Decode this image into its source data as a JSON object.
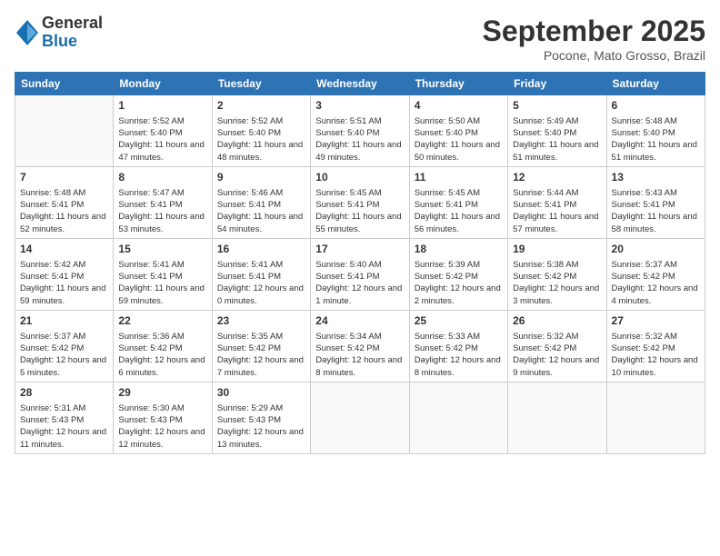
{
  "header": {
    "logo_general": "General",
    "logo_blue": "Blue",
    "month_title": "September 2025",
    "location": "Pocone, Mato Grosso, Brazil"
  },
  "days_of_week": [
    "Sunday",
    "Monday",
    "Tuesday",
    "Wednesday",
    "Thursday",
    "Friday",
    "Saturday"
  ],
  "weeks": [
    [
      {
        "day": "",
        "sunrise": "",
        "sunset": "",
        "daylight": ""
      },
      {
        "day": "1",
        "sunrise": "Sunrise: 5:52 AM",
        "sunset": "Sunset: 5:40 PM",
        "daylight": "Daylight: 11 hours and 47 minutes."
      },
      {
        "day": "2",
        "sunrise": "Sunrise: 5:52 AM",
        "sunset": "Sunset: 5:40 PM",
        "daylight": "Daylight: 11 hours and 48 minutes."
      },
      {
        "day": "3",
        "sunrise": "Sunrise: 5:51 AM",
        "sunset": "Sunset: 5:40 PM",
        "daylight": "Daylight: 11 hours and 49 minutes."
      },
      {
        "day": "4",
        "sunrise": "Sunrise: 5:50 AM",
        "sunset": "Sunset: 5:40 PM",
        "daylight": "Daylight: 11 hours and 50 minutes."
      },
      {
        "day": "5",
        "sunrise": "Sunrise: 5:49 AM",
        "sunset": "Sunset: 5:40 PM",
        "daylight": "Daylight: 11 hours and 51 minutes."
      },
      {
        "day": "6",
        "sunrise": "Sunrise: 5:48 AM",
        "sunset": "Sunset: 5:40 PM",
        "daylight": "Daylight: 11 hours and 51 minutes."
      }
    ],
    [
      {
        "day": "7",
        "sunrise": "Sunrise: 5:48 AM",
        "sunset": "Sunset: 5:41 PM",
        "daylight": "Daylight: 11 hours and 52 minutes."
      },
      {
        "day": "8",
        "sunrise": "Sunrise: 5:47 AM",
        "sunset": "Sunset: 5:41 PM",
        "daylight": "Daylight: 11 hours and 53 minutes."
      },
      {
        "day": "9",
        "sunrise": "Sunrise: 5:46 AM",
        "sunset": "Sunset: 5:41 PM",
        "daylight": "Daylight: 11 hours and 54 minutes."
      },
      {
        "day": "10",
        "sunrise": "Sunrise: 5:45 AM",
        "sunset": "Sunset: 5:41 PM",
        "daylight": "Daylight: 11 hours and 55 minutes."
      },
      {
        "day": "11",
        "sunrise": "Sunrise: 5:45 AM",
        "sunset": "Sunset: 5:41 PM",
        "daylight": "Daylight: 11 hours and 56 minutes."
      },
      {
        "day": "12",
        "sunrise": "Sunrise: 5:44 AM",
        "sunset": "Sunset: 5:41 PM",
        "daylight": "Daylight: 11 hours and 57 minutes."
      },
      {
        "day": "13",
        "sunrise": "Sunrise: 5:43 AM",
        "sunset": "Sunset: 5:41 PM",
        "daylight": "Daylight: 11 hours and 58 minutes."
      }
    ],
    [
      {
        "day": "14",
        "sunrise": "Sunrise: 5:42 AM",
        "sunset": "Sunset: 5:41 PM",
        "daylight": "Daylight: 11 hours and 59 minutes."
      },
      {
        "day": "15",
        "sunrise": "Sunrise: 5:41 AM",
        "sunset": "Sunset: 5:41 PM",
        "daylight": "Daylight: 11 hours and 59 minutes."
      },
      {
        "day": "16",
        "sunrise": "Sunrise: 5:41 AM",
        "sunset": "Sunset: 5:41 PM",
        "daylight": "Daylight: 12 hours and 0 minutes."
      },
      {
        "day": "17",
        "sunrise": "Sunrise: 5:40 AM",
        "sunset": "Sunset: 5:41 PM",
        "daylight": "Daylight: 12 hours and 1 minute."
      },
      {
        "day": "18",
        "sunrise": "Sunrise: 5:39 AM",
        "sunset": "Sunset: 5:42 PM",
        "daylight": "Daylight: 12 hours and 2 minutes."
      },
      {
        "day": "19",
        "sunrise": "Sunrise: 5:38 AM",
        "sunset": "Sunset: 5:42 PM",
        "daylight": "Daylight: 12 hours and 3 minutes."
      },
      {
        "day": "20",
        "sunrise": "Sunrise: 5:37 AM",
        "sunset": "Sunset: 5:42 PM",
        "daylight": "Daylight: 12 hours and 4 minutes."
      }
    ],
    [
      {
        "day": "21",
        "sunrise": "Sunrise: 5:37 AM",
        "sunset": "Sunset: 5:42 PM",
        "daylight": "Daylight: 12 hours and 5 minutes."
      },
      {
        "day": "22",
        "sunrise": "Sunrise: 5:36 AM",
        "sunset": "Sunset: 5:42 PM",
        "daylight": "Daylight: 12 hours and 6 minutes."
      },
      {
        "day": "23",
        "sunrise": "Sunrise: 5:35 AM",
        "sunset": "Sunset: 5:42 PM",
        "daylight": "Daylight: 12 hours and 7 minutes."
      },
      {
        "day": "24",
        "sunrise": "Sunrise: 5:34 AM",
        "sunset": "Sunset: 5:42 PM",
        "daylight": "Daylight: 12 hours and 8 minutes."
      },
      {
        "day": "25",
        "sunrise": "Sunrise: 5:33 AM",
        "sunset": "Sunset: 5:42 PM",
        "daylight": "Daylight: 12 hours and 8 minutes."
      },
      {
        "day": "26",
        "sunrise": "Sunrise: 5:32 AM",
        "sunset": "Sunset: 5:42 PM",
        "daylight": "Daylight: 12 hours and 9 minutes."
      },
      {
        "day": "27",
        "sunrise": "Sunrise: 5:32 AM",
        "sunset": "Sunset: 5:42 PM",
        "daylight": "Daylight: 12 hours and 10 minutes."
      }
    ],
    [
      {
        "day": "28",
        "sunrise": "Sunrise: 5:31 AM",
        "sunset": "Sunset: 5:43 PM",
        "daylight": "Daylight: 12 hours and 11 minutes."
      },
      {
        "day": "29",
        "sunrise": "Sunrise: 5:30 AM",
        "sunset": "Sunset: 5:43 PM",
        "daylight": "Daylight: 12 hours and 12 minutes."
      },
      {
        "day": "30",
        "sunrise": "Sunrise: 5:29 AM",
        "sunset": "Sunset: 5:43 PM",
        "daylight": "Daylight: 12 hours and 13 minutes."
      },
      {
        "day": "",
        "sunrise": "",
        "sunset": "",
        "daylight": ""
      },
      {
        "day": "",
        "sunrise": "",
        "sunset": "",
        "daylight": ""
      },
      {
        "day": "",
        "sunrise": "",
        "sunset": "",
        "daylight": ""
      },
      {
        "day": "",
        "sunrise": "",
        "sunset": "",
        "daylight": ""
      }
    ]
  ]
}
